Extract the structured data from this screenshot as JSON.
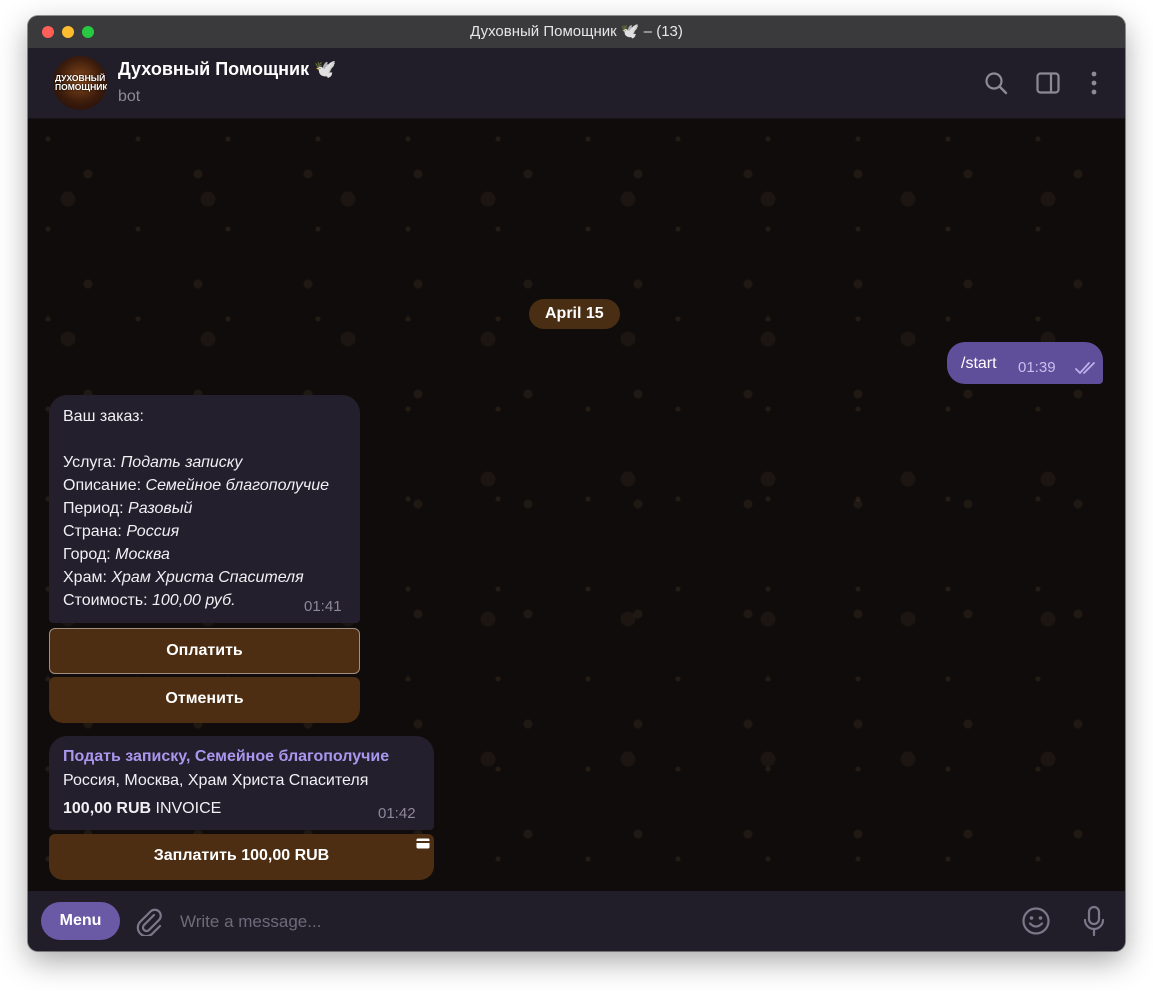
{
  "window": {
    "title": "Духовный Помощник 🕊️ – (13)"
  },
  "header": {
    "avatar_text": "ДУХОВНЫЙ ПОМОЩНИК",
    "chat_name": "Духовный Помощник 🕊️",
    "chat_status": "bot",
    "icons": [
      "search-icon",
      "sidebar-toggle-icon",
      "more-vertical-icon"
    ]
  },
  "chat": {
    "date_separator": "April 15",
    "outgoing": {
      "text": "/start",
      "time": "01:39",
      "status": "read"
    },
    "order": {
      "lines": [
        {
          "label": "Ваш заказ:",
          "value": ""
        },
        {
          "label": "Услуга: ",
          "value": "Подать записку"
        },
        {
          "label": "Описание: ",
          "value": "Семейное благополучие"
        },
        {
          "label": "Период: ",
          "value": "Разовый"
        },
        {
          "label": "Страна: ",
          "value": "Россия"
        },
        {
          "label": "Город: ",
          "value": "Москва"
        },
        {
          "label": "Храм: ",
          "value": "Храм Христа Спасителя"
        },
        {
          "label": "Стоимость: ",
          "value": "100,00 руб."
        }
      ],
      "time": "01:41",
      "buttons": [
        "Оплатить",
        "Отменить"
      ]
    },
    "invoice": {
      "title": "Подать записку, Семейное благополучие",
      "description": "Россия, Москва, Храм Христа Спасителя",
      "amount": "100,00 RUB",
      "label": "INVOICE",
      "time": "01:42",
      "pay_button": "Заплатить 100,00 RUB"
    }
  },
  "composer": {
    "menu_label": "Menu",
    "placeholder": "Write a message...",
    "value": ""
  },
  "colors": {
    "accent": "#6a5aa6",
    "outgoing_bubble": "#5f4f9a",
    "incoming_bubble": "#241f2c",
    "button_brown": "#4d2e12",
    "invoice_title": "#a897ee"
  }
}
